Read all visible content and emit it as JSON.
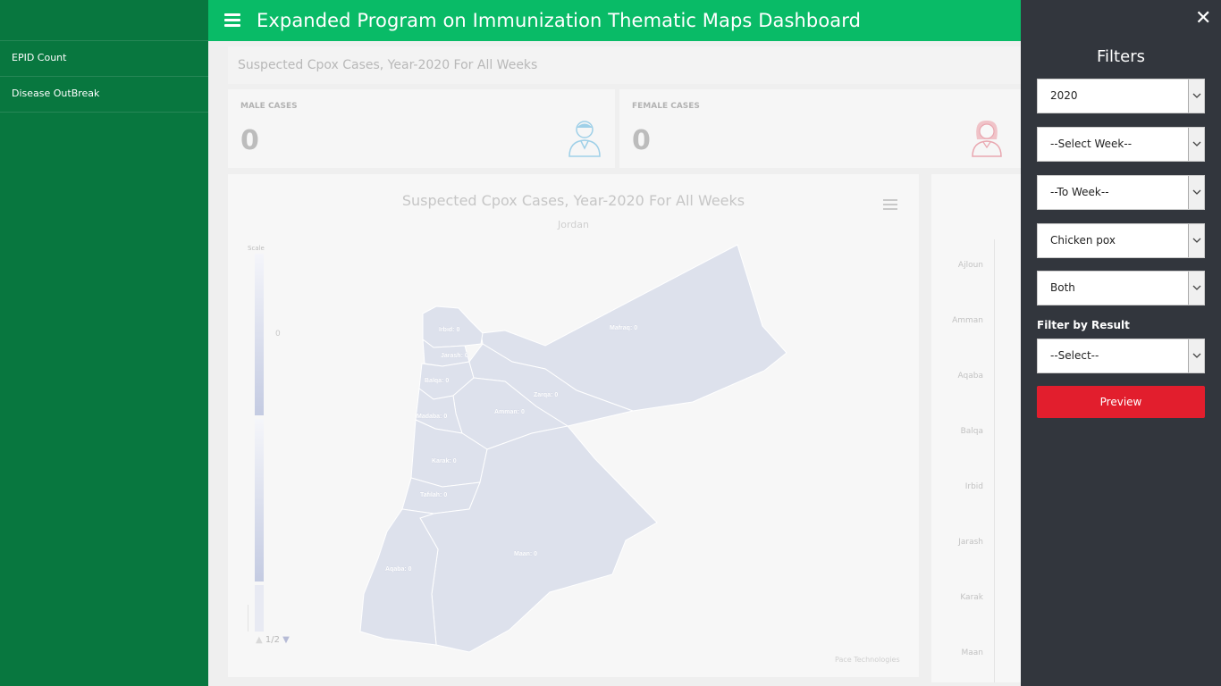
{
  "app_title": "Expanded Program on Immunization Thematic Maps Dashboard",
  "sidebar": {
    "items": [
      {
        "label": "EPID Count"
      },
      {
        "label": "Disease OutBreak"
      }
    ]
  },
  "header": {
    "page_title": "Suspected Cpox Cases, Year-2020 For All Weeks"
  },
  "cards": {
    "male": {
      "label": "MALE CASES",
      "value": "0",
      "icon": "male-user-icon"
    },
    "female": {
      "label": "FEMALE CASES",
      "value": "0",
      "icon": "female-user-icon"
    }
  },
  "map": {
    "title": "Suspected Cpox Cases, Year-2020 For All Weeks",
    "subtitle": "Jordan",
    "legend_title": "Scale",
    "legend_zero": "0",
    "pager": "1/2",
    "credits": "Pace Technologies",
    "regions": [
      {
        "label": "Irbid: 0"
      },
      {
        "label": "Jarash: 0"
      },
      {
        "label": "Balqa: 0"
      },
      {
        "label": "Zarqa: 0"
      },
      {
        "label": "Madaba: 0"
      },
      {
        "label": "Amman: 0"
      },
      {
        "label": "Mafraq: 0"
      },
      {
        "label": "Karak: 0"
      },
      {
        "label": "Tafilah: 0"
      },
      {
        "label": "Maan: 0"
      },
      {
        "label": "Aqaba: 0"
      }
    ],
    "colors": {
      "fill": "#dde1ec",
      "stroke": "#ffffff"
    }
  },
  "bar_panel": {
    "labels": [
      "Ajloun",
      "Amman",
      "Aqaba",
      "Balqa",
      "Irbid",
      "Jarash",
      "Karak",
      "Maan"
    ]
  },
  "filters": {
    "title": "Filters",
    "close_icon": "close-icon",
    "year": "2020",
    "from_week": "--Select Week--",
    "to_week": "--To Week--",
    "disease": "Chicken pox",
    "gender": "Both",
    "result_label": "Filter by Result",
    "result": "--Select--",
    "preview_label": "Preview"
  },
  "colors": {
    "sidebar": "#08773f",
    "topbar": "#09bb67",
    "filters_bg": "#32363d",
    "preview": "#e21e2d"
  }
}
